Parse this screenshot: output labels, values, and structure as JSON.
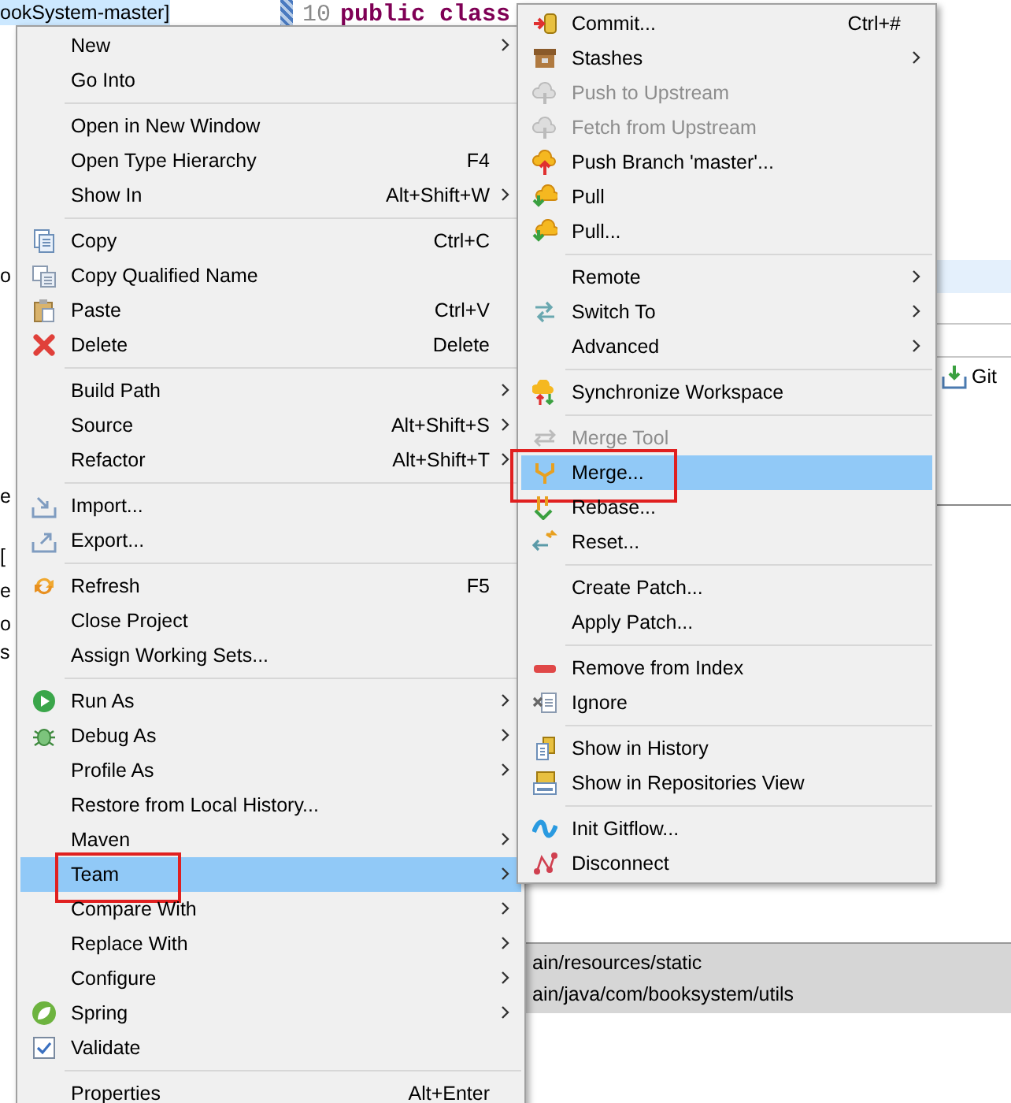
{
  "project_tree": {
    "selected_item": "ookSystem-master]",
    "fragments": [
      "o",
      "e",
      "[",
      "e",
      "o",
      "s"
    ]
  },
  "editor": {
    "line_number": "10",
    "code": "public class"
  },
  "toolbar": {
    "git_label": "Git"
  },
  "paths": [
    "ain/resources/static",
    "ain/java/com/booksystem/utils"
  ],
  "context_menu": {
    "groups": [
      [
        {
          "label": "New",
          "submenu": true,
          "selected": false
        },
        {
          "label": "Go Into",
          "selected": false
        }
      ],
      [
        {
          "label": "Open in New Window",
          "selected": false
        },
        {
          "label": "Open Type Hierarchy",
          "shortcut": "F4",
          "selected": false
        },
        {
          "label": "Show In",
          "shortcut": "Alt+Shift+W",
          "submenu": true,
          "selected": false
        }
      ],
      [
        {
          "label": "Copy",
          "shortcut": "Ctrl+C",
          "selected": false
        },
        {
          "label": "Copy Qualified Name",
          "selected": false
        },
        {
          "label": "Paste",
          "shortcut": "Ctrl+V",
          "selected": false
        },
        {
          "label": "Delete",
          "shortcut": "Delete",
          "selected": false
        }
      ],
      [
        {
          "label": "Build Path",
          "submenu": true,
          "selected": false
        },
        {
          "label": "Source",
          "shortcut": "Alt+Shift+S",
          "submenu": true,
          "selected": false
        },
        {
          "label": "Refactor",
          "shortcut": "Alt+Shift+T",
          "submenu": true,
          "selected": false
        }
      ],
      [
        {
          "label": "Import...",
          "selected": false
        },
        {
          "label": "Export...",
          "selected": false
        }
      ],
      [
        {
          "label": "Refresh",
          "shortcut": "F5",
          "selected": false
        },
        {
          "label": "Close Project",
          "selected": false
        },
        {
          "label": "Assign Working Sets...",
          "selected": false
        }
      ],
      [
        {
          "label": "Run As",
          "submenu": true,
          "selected": false
        },
        {
          "label": "Debug As",
          "submenu": true,
          "selected": false
        },
        {
          "label": "Profile As",
          "submenu": true,
          "selected": false
        },
        {
          "label": "Restore from Local History...",
          "selected": false
        },
        {
          "label": "Maven",
          "submenu": true,
          "selected": false
        },
        {
          "label": "Team",
          "submenu": true,
          "selected": true,
          "annotated": true
        },
        {
          "label": "Compare With",
          "submenu": true,
          "selected": false
        },
        {
          "label": "Replace With",
          "submenu": true,
          "selected": false
        },
        {
          "label": "Configure",
          "submenu": true,
          "selected": false
        },
        {
          "label": "Spring",
          "submenu": true,
          "selected": false
        },
        {
          "label": "Validate",
          "selected": false
        }
      ],
      [
        {
          "label": "Properties",
          "shortcut": "Alt+Enter",
          "selected": false
        }
      ]
    ]
  },
  "team_submenu": {
    "groups": [
      [
        {
          "label": "Commit...",
          "shortcut": "Ctrl+#",
          "selected": false
        },
        {
          "label": "Stashes",
          "submenu": true,
          "selected": false
        },
        {
          "label": "Push to Upstream",
          "disabled": true,
          "selected": false
        },
        {
          "label": "Fetch from Upstream",
          "disabled": true,
          "selected": false
        },
        {
          "label": "Push Branch 'master'...",
          "selected": false
        },
        {
          "label": "Pull",
          "selected": false
        },
        {
          "label": "Pull...",
          "selected": false
        }
      ],
      [
        {
          "label": "Remote",
          "submenu": true,
          "selected": false
        },
        {
          "label": "Switch To",
          "submenu": true,
          "selected": false
        },
        {
          "label": "Advanced",
          "submenu": true,
          "selected": false
        }
      ],
      [
        {
          "label": "Synchronize Workspace",
          "selected": false
        }
      ],
      [
        {
          "label": "Merge Tool",
          "disabled": true,
          "selected": false
        },
        {
          "label": "Merge...",
          "selected": true,
          "annotated": true
        },
        {
          "label": "Rebase...",
          "selected": false
        },
        {
          "label": "Reset...",
          "selected": false
        }
      ],
      [
        {
          "label": "Create Patch...",
          "selected": false
        },
        {
          "label": "Apply Patch...",
          "selected": false
        }
      ],
      [
        {
          "label": "Remove from Index",
          "selected": false
        },
        {
          "label": "Ignore",
          "selected": false
        }
      ],
      [
        {
          "label": "Show in History",
          "selected": false
        },
        {
          "label": "Show in Repositories View",
          "selected": false
        }
      ],
      [
        {
          "label": "Init Gitflow...",
          "selected": false
        },
        {
          "label": "Disconnect",
          "selected": false
        }
      ]
    ]
  }
}
